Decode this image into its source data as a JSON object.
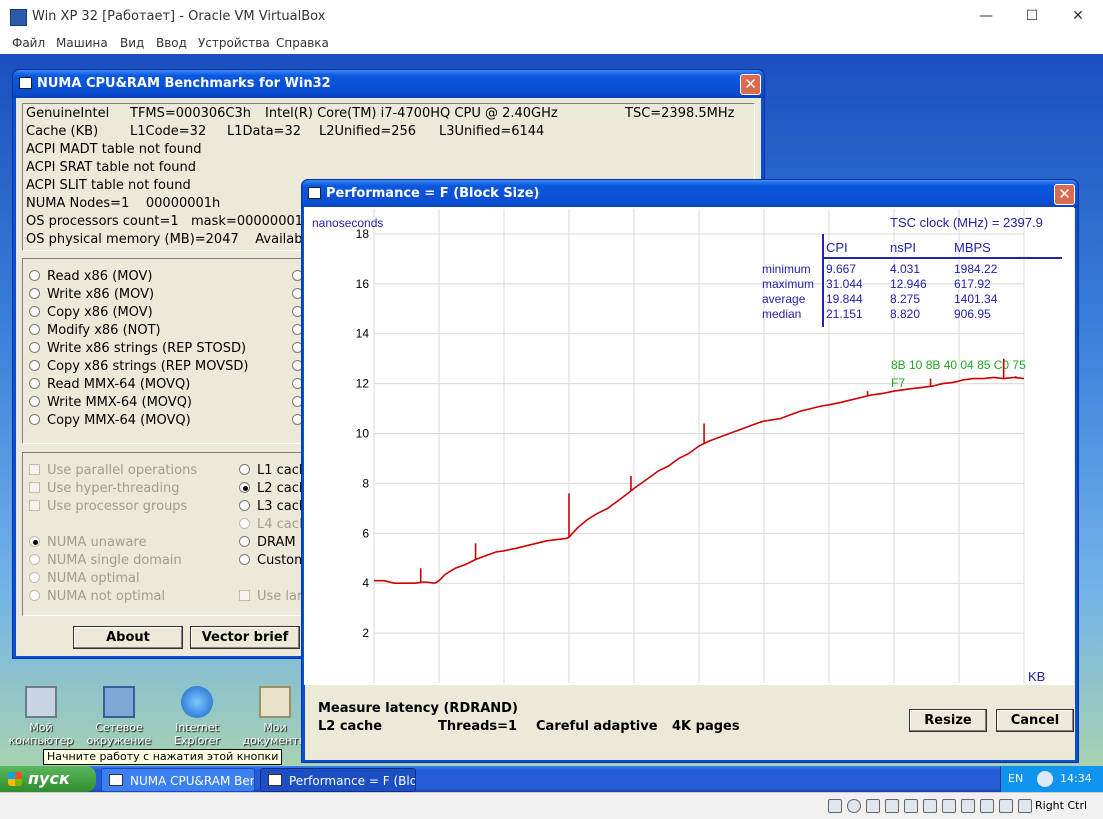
{
  "host": {
    "title": "Win XP 32 [Работает] - Oracle VM VirtualBox",
    "menu": [
      "Файл",
      "Машина",
      "Вид",
      "Ввод",
      "Устройства",
      "Справка"
    ],
    "status_key": "Right Ctrl"
  },
  "numa_window": {
    "title": "NUMA CPU&RAM Benchmarks for Win32",
    "info": {
      "vendor": "GenuineIntel",
      "tfms": "TFMS=000306C3h",
      "cpu": "Intel(R) Core(TM) i7-4700HQ CPU @ 2.40GHz",
      "tsc": "TSC=2398.5MHz",
      "cache": "Cache (KB)",
      "l1code": "L1Code=32",
      "l1data": "L1Data=32",
      "l2": "L2Unified=256",
      "l3": "L3Unified=6144",
      "madt": "ACPI MADT table not found",
      "srat": "ACPI SRAT table not found",
      "slit": "ACPI SLIT table not found",
      "nodes": "NUMA Nodes=1    00000001h",
      "procs": "OS processors count=1   mask=00000001",
      "mem": "OS physical memory (MB)=2047    Availab"
    },
    "methods": [
      "Read x86 (MOV)",
      "Write x86 (MOV)",
      "Copy x86 (MOV)",
      "Modify x86 (NOT)",
      "Write x86 strings (REP STOSD)",
      "Copy x86 strings (REP MOVSD)",
      "Read MMX-64 (MOVQ)",
      "Write MMX-64 (MOVQ)",
      "Copy MMX-64 (MOVQ)"
    ],
    "options": [
      "Use parallel operations",
      "Use hyper-threading",
      "Use processor groups"
    ],
    "numa_modes": [
      "NUMA unaware",
      "NUMA single domain",
      "NUMA optimal",
      "NUMA not optimal"
    ],
    "targets": [
      "L1 cach",
      "L2 cach",
      "L3 cach",
      "L4 cach",
      "DRAM",
      "Custom"
    ],
    "use_large": "Use lar",
    "about_label": "About",
    "vector_label": "Vector brief"
  },
  "perf_window": {
    "title": "Performance = F (Block Size)",
    "ylabel": "nanoseconds",
    "xlabel": "KB",
    "tsc_label": "TSC clock (MHz)  = 2397.9",
    "table": {
      "headers": [
        "CPI",
        "nsPI",
        "MBPS"
      ],
      "rows": [
        {
          "name": "minimum",
          "cpi": "9.667",
          "nspi": "4.031",
          "mbps": "1984.22"
        },
        {
          "name": "maximum",
          "cpi": "31.044",
          "nspi": "12.946",
          "mbps": "617.92"
        },
        {
          "name": "average",
          "cpi": "19.844",
          "nspi": "8.275",
          "mbps": "1401.34"
        },
        {
          "name": "median",
          "cpi": "21.151",
          "nspi": "8.820",
          "mbps": "906.95"
        }
      ]
    },
    "bytes_line1": "8B  10  8B  40  04  85  C0  75",
    "bytes_line2": "F7",
    "status_line1": "Measure latency (RDRAND)",
    "status_l2": "L2 cache",
    "status_threads": "Threads=1",
    "status_mode": "Careful adaptive",
    "status_pages": "4K pages",
    "resize_label": "Resize",
    "cancel_label": "Cancel"
  },
  "chart_data": {
    "type": "line",
    "title": "Performance = F (Block Size)",
    "xlabel": "KB",
    "ylabel": "nanoseconds",
    "xlim": [
      0,
      640
    ],
    "ylim": [
      0,
      19
    ],
    "xticks": [
      0,
      64,
      128,
      192,
      256,
      320,
      384,
      448,
      512,
      576,
      640
    ],
    "yticks": [
      2,
      4,
      6,
      8,
      10,
      12,
      14,
      16,
      18
    ],
    "grid": true,
    "color": "#cc0000",
    "series": [
      {
        "x": [
          0,
          10,
          20,
          30,
          40,
          50,
          60,
          64,
          70,
          80,
          90,
          100,
          110,
          120,
          128,
          140,
          150,
          160,
          170,
          180,
          190,
          192,
          200,
          210,
          220,
          230,
          240,
          250,
          256,
          270,
          280,
          290,
          300,
          310,
          320,
          330,
          340,
          350,
          360,
          370,
          380,
          384,
          400,
          410,
          420,
          430,
          440,
          448,
          460,
          470,
          480,
          490,
          500,
          512,
          520,
          530,
          540,
          550,
          560,
          570,
          576,
          580,
          590,
          600,
          610,
          620,
          630,
          640
        ],
        "y": [
          4.1,
          4.1,
          4.0,
          4.0,
          4.0,
          4.05,
          4.0,
          4.1,
          4.35,
          4.6,
          4.75,
          4.95,
          5.1,
          5.25,
          5.3,
          5.4,
          5.5,
          5.6,
          5.7,
          5.75,
          5.8,
          5.85,
          6.2,
          6.55,
          6.8,
          7.0,
          7.3,
          7.6,
          7.8,
          8.2,
          8.5,
          8.7,
          9.0,
          9.2,
          9.5,
          9.7,
          9.85,
          10.0,
          10.15,
          10.3,
          10.45,
          10.5,
          10.6,
          10.75,
          10.9,
          11.0,
          11.1,
          11.15,
          11.25,
          11.35,
          11.45,
          11.55,
          11.6,
          11.7,
          11.75,
          11.8,
          11.85,
          11.9,
          12.0,
          12.05,
          12.1,
          12.15,
          12.2,
          12.2,
          12.25,
          12.2,
          12.25,
          12.2
        ]
      }
    ],
    "spikes": [
      [
        46,
        4.6
      ],
      [
        100,
        5.6
      ],
      [
        192,
        7.6
      ],
      [
        253,
        8.3
      ],
      [
        325,
        10.4
      ],
      [
        486,
        11.7
      ],
      [
        548,
        12.2
      ],
      [
        620,
        13.0
      ],
      [
        632,
        12.3
      ]
    ]
  },
  "taskbar": {
    "start_label": "пуск",
    "tasks": [
      "NUMA CPU&RAM Ben...",
      "Performance = F (Blo..."
    ],
    "lang": "EN",
    "clock": "14:34",
    "tooltip": "Начните работу с нажатия этой кнопки"
  },
  "desktop_icons": [
    "Мой компьютер",
    "Сетевое окружение",
    "Internet Explorer",
    "Мои документы"
  ]
}
